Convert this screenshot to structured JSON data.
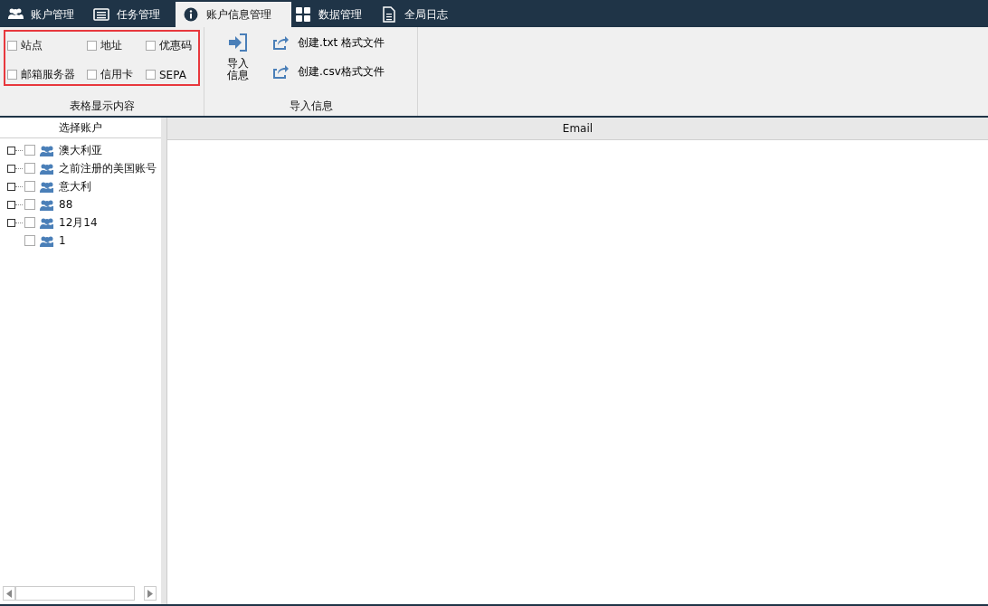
{
  "tabs": [
    {
      "label": "账户管理",
      "selected": false
    },
    {
      "label": "任务管理",
      "selected": false
    },
    {
      "label": "账户信息管理",
      "selected": true
    },
    {
      "label": "数据管理",
      "selected": false
    },
    {
      "label": "全局日志",
      "selected": false
    }
  ],
  "ribbon": {
    "display_group": {
      "title": "表格显示内容",
      "options": [
        {
          "label": "站点",
          "checked": false
        },
        {
          "label": "地址",
          "checked": false
        },
        {
          "label": "优惠码",
          "checked": false
        },
        {
          "label": "邮箱服务器",
          "checked": false
        },
        {
          "label": "信用卡",
          "checked": false
        },
        {
          "label": "SEPA",
          "checked": false
        }
      ]
    },
    "import_group": {
      "title": "导入信息",
      "import_button": "导入信息",
      "actions": [
        "创建.txt 格式文件",
        "创建.csv格式文件"
      ]
    }
  },
  "account_panel": {
    "header": "选择账户",
    "items": [
      {
        "label": "澳大利亚",
        "expandable": true,
        "checked": false
      },
      {
        "label": "之前注册的美国账号",
        "expandable": true,
        "checked": false
      },
      {
        "label": "意大利",
        "expandable": true,
        "checked": false
      },
      {
        "label": "88",
        "expandable": true,
        "checked": false
      },
      {
        "label": "12月14",
        "expandable": true,
        "checked": false
      },
      {
        "label": "1",
        "expandable": false,
        "checked": false
      }
    ]
  },
  "table": {
    "columns": [
      "Email"
    ]
  }
}
